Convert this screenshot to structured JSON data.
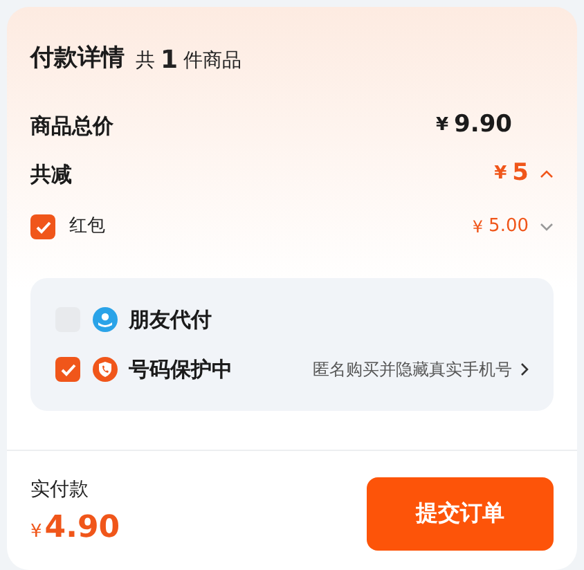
{
  "header": {
    "title": "付款详情",
    "count_prefix": "共",
    "count": "1",
    "count_suffix": "件商品"
  },
  "total": {
    "label": "商品总价",
    "currency": "¥",
    "amount": "9.90"
  },
  "discount": {
    "label": "共减",
    "currency": "¥",
    "amount": "5",
    "expanded": true
  },
  "coupons": [
    {
      "label": "红包",
      "checked": true,
      "currency": "¥",
      "amount": "5.00"
    }
  ],
  "options": [
    {
      "kind": "friend",
      "label": "朋友代付",
      "checked": false
    },
    {
      "kind": "privacy",
      "label": "号码保护中",
      "checked": true,
      "hint": "匿名购买并隐藏真实手机号"
    }
  ],
  "footer": {
    "label": "实付款",
    "currency": "¥",
    "amount": "4.90",
    "button": "提交订单"
  }
}
